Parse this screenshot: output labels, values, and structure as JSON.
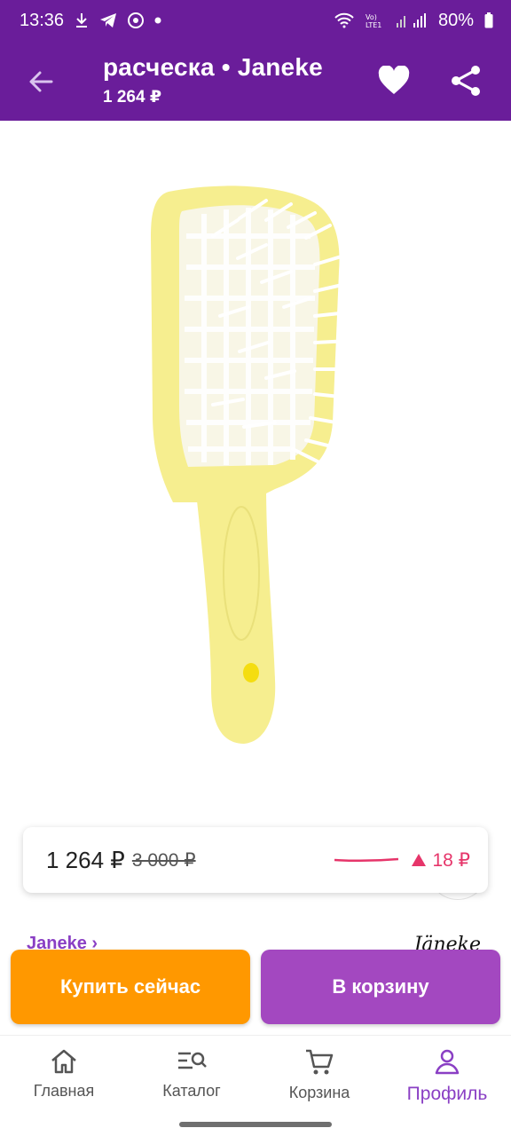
{
  "status_bar": {
    "time": "13:36",
    "battery": "80%",
    "icons_left": [
      "download-icon",
      "telegram-icon",
      "chrome-icon",
      "dot-icon"
    ],
    "icons_right": [
      "wifi-icon",
      "volte-icon",
      "signal-icon",
      "battery-icon"
    ]
  },
  "header": {
    "title": "расческа • Janeke",
    "price": "1 264 ₽",
    "icons": [
      "back-arrow-icon",
      "heart-icon",
      "share-icon"
    ]
  },
  "product": {
    "image": "yellow-hairbrush",
    "visual_search_icon": "visual-search-icon"
  },
  "price_card": {
    "price": "1 264 ₽",
    "old_price": "3 000 ₽",
    "change": "18 ₽",
    "change_color": "#e6356a"
  },
  "brand": {
    "link": "Janeke ›",
    "logo_text": "Jäneke"
  },
  "actions": {
    "buy_now": "Купить сейчас",
    "add_to_cart": "В корзину",
    "buy_color": "#ff9800",
    "cart_color": "#a348c0"
  },
  "bottom_nav": {
    "items": [
      {
        "label": "Главная",
        "icon": "home-icon"
      },
      {
        "label": "Каталог",
        "icon": "catalog-search-icon"
      },
      {
        "label": "Корзина",
        "icon": "cart-icon"
      },
      {
        "label": "Профиль",
        "icon": "profile-icon",
        "active": true
      }
    ]
  },
  "colors": {
    "brand_purple": "#6a1d9a",
    "accent_purple": "#8a3fc4"
  }
}
